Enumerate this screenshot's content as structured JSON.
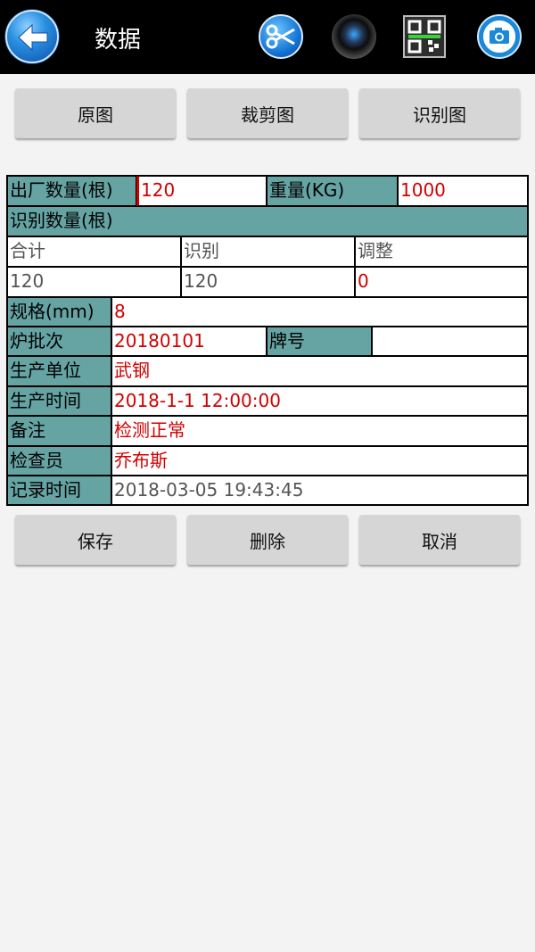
{
  "header": {
    "title": "数据"
  },
  "icons": {
    "back": "back-arrow-icon",
    "crop": "scissors-icon",
    "camera_lens": "camera-lens-icon",
    "qr": "qr-code-icon",
    "photo": "camera-icon"
  },
  "image_tabs": {
    "original": "原图",
    "cropped": "裁剪图",
    "recognized": "识别图"
  },
  "form": {
    "factory_qty_label": "出厂数量(根)",
    "factory_qty_value": "120",
    "weight_label": "重量(KG)",
    "weight_value": "1000",
    "recognized_qty_header": "识别数量(根)",
    "sub_headers": {
      "total": "合计",
      "recognized": "识别",
      "adjust": "调整"
    },
    "sub_values": {
      "total": "120",
      "recognized": "120",
      "adjust": "0"
    },
    "spec_label": "规格(mm)",
    "spec_value": "8",
    "batch_label": "炉批次",
    "batch_value": "20180101",
    "brand_label": "牌号",
    "brand_value": "",
    "producer_label": "生产单位",
    "producer_value": "武钢",
    "prod_time_label": "生产时间",
    "prod_time_value": "2018-1-1 12:00:00",
    "remark_label": "备注",
    "remark_value": "检测正常",
    "inspector_label": "检查员",
    "inspector_value": "乔布斯",
    "record_time_label": "记录时间",
    "record_time_value": "2018-03-05 19:43:45"
  },
  "actions": {
    "save": "保存",
    "delete": "删除",
    "cancel": "取消"
  },
  "colors": {
    "label_bg": "#66a3a3",
    "value_text": "#d10000",
    "topbar": "#000000"
  }
}
